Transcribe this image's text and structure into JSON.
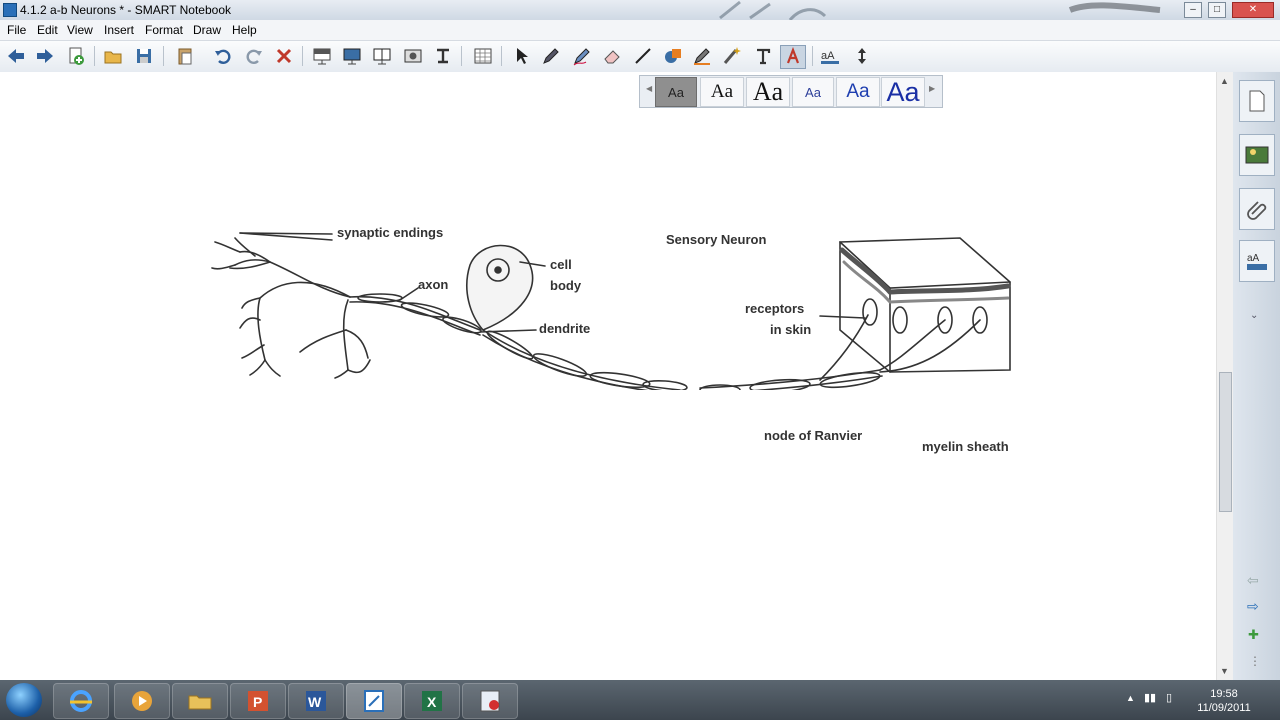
{
  "window": {
    "title": "4.1.2 a-b Neurons * - SMART Notebook"
  },
  "menu": [
    "File",
    "Edit",
    "View",
    "Insert",
    "Format",
    "Draw",
    "Help"
  ],
  "toolbar_icons": [
    "back-icon",
    "forward-icon",
    "add-page-icon",
    "open-icon",
    "save-icon",
    "paste-icon",
    "undo-icon",
    "redo-icon",
    "delete-icon",
    "screen-shade-icon",
    "full-screen-icon",
    "dual-page-icon",
    "screen-capture-icon",
    "document-camera-icon",
    "table-icon",
    "select-icon",
    "pen-icon",
    "creative-pen-icon",
    "eraser-icon",
    "line-icon",
    "shape-icon",
    "fill-icon",
    "magic-pen-icon",
    "text-icon",
    "properties-icon",
    "move-toolbar-icon"
  ],
  "font_styles": [
    "Aa",
    "Aa",
    "Aa",
    "Aa",
    "Aa",
    "Aa"
  ],
  "diagram": {
    "title": "Sensory Neuron",
    "labels": {
      "synaptic_endings": "synaptic endings",
      "axon": "axon",
      "cell": "cell",
      "body": "body",
      "dendrite": "dendrite",
      "receptors": "receptors",
      "in_skin": "in skin",
      "node_of_ranvier": "node of Ranvier",
      "myelin_sheath": "myelin sheath"
    }
  },
  "taskbar": {
    "time": "19:58",
    "date": "11/09/2011"
  },
  "colors": {
    "accent": "#2a6fb8",
    "taskbar": "#3c454e"
  }
}
